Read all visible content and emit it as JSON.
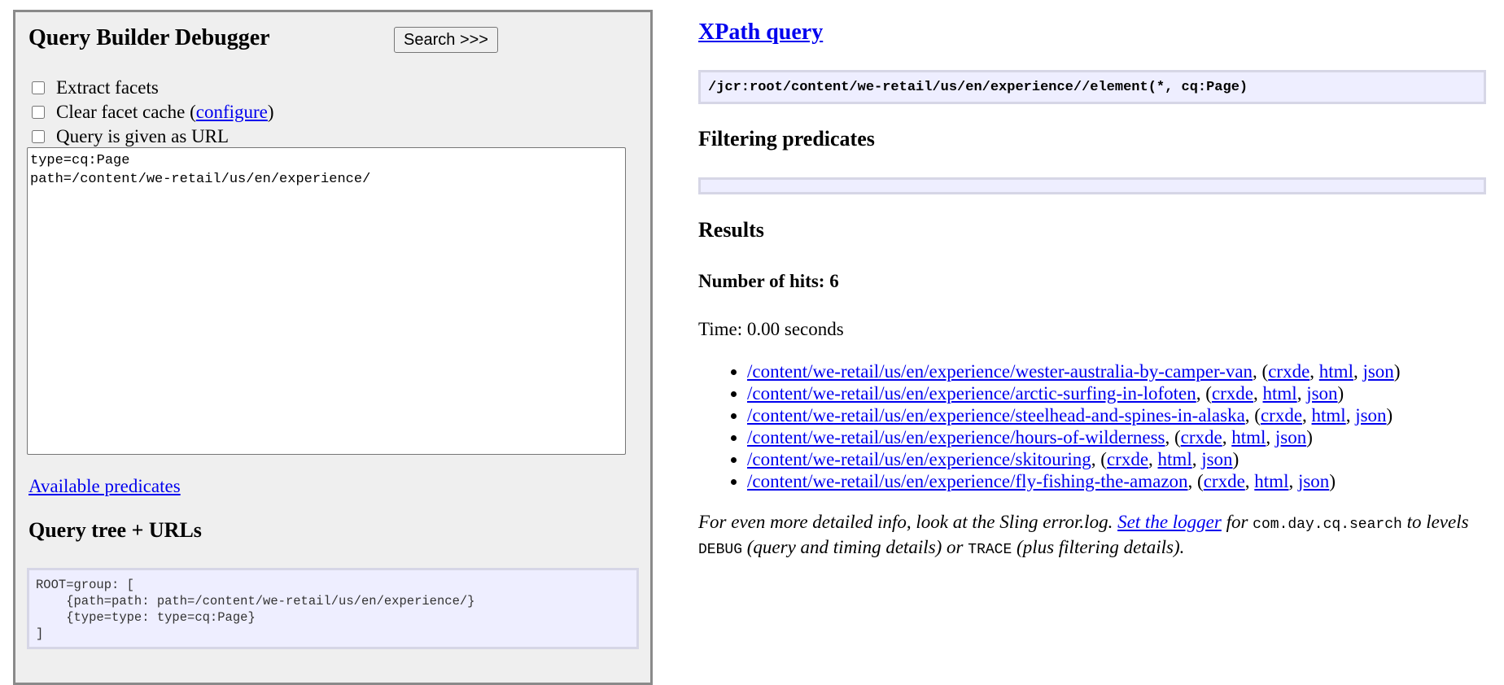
{
  "left": {
    "title": "Query Builder Debugger",
    "search_label": "Search >>>",
    "options": {
      "extract_facets": "Extract facets",
      "clear_cache_prefix": "Clear facet cache (",
      "configure_link": "configure",
      "clear_cache_suffix": ")",
      "query_as_url": "Query is given as URL"
    },
    "query_text": "type=cq:Page\npath=/content/we-retail/us/en/experience/",
    "available_predicates": "Available predicates",
    "tree_heading": "Query tree + URLs",
    "tree_text": "ROOT=group: [\n    {path=path: path=/content/we-retail/us/en/experience/}\n    {type=type: type=cq:Page}\n]"
  },
  "right": {
    "xpath_heading": "XPath query",
    "xpath_value": "/jcr:root/content/we-retail/us/en/experience//element(*, cq:Page)",
    "filtering_heading": "Filtering predicates",
    "results_heading": "Results",
    "hits_text": "Number of hits: 6",
    "time_text": "Time: 0.00 seconds",
    "results": [
      {
        "path": "/content/we-retail/us/en/experience/wester-australia-by-camper-van",
        "crxde": "crxde",
        "html": "html",
        "json": "json"
      },
      {
        "path": "/content/we-retail/us/en/experience/arctic-surfing-in-lofoten",
        "crxde": "crxde",
        "html": "html",
        "json": "json"
      },
      {
        "path": "/content/we-retail/us/en/experience/steelhead-and-spines-in-alaska",
        "crxde": "crxde",
        "html": "html",
        "json": "json"
      },
      {
        "path": "/content/we-retail/us/en/experience/hours-of-wilderness",
        "crxde": "crxde",
        "html": "html",
        "json": "json"
      },
      {
        "path": "/content/we-retail/us/en/experience/skitouring",
        "crxde": "crxde",
        "html": "html",
        "json": "json"
      },
      {
        "path": "/content/we-retail/us/en/experience/fly-fishing-the-amazon",
        "crxde": "crxde",
        "html": "html",
        "json": "json"
      }
    ],
    "note": {
      "part1": "For even more detailed info, look at the Sling error.log. ",
      "logger_link": "Set the logger",
      "part2": " for ",
      "code1": "com.day.cq.search",
      "part3": " to levels ",
      "code2": "DEBUG",
      "part4": " (query and timing details) or ",
      "code3": "TRACE",
      "part5": " (plus filtering details)."
    }
  }
}
